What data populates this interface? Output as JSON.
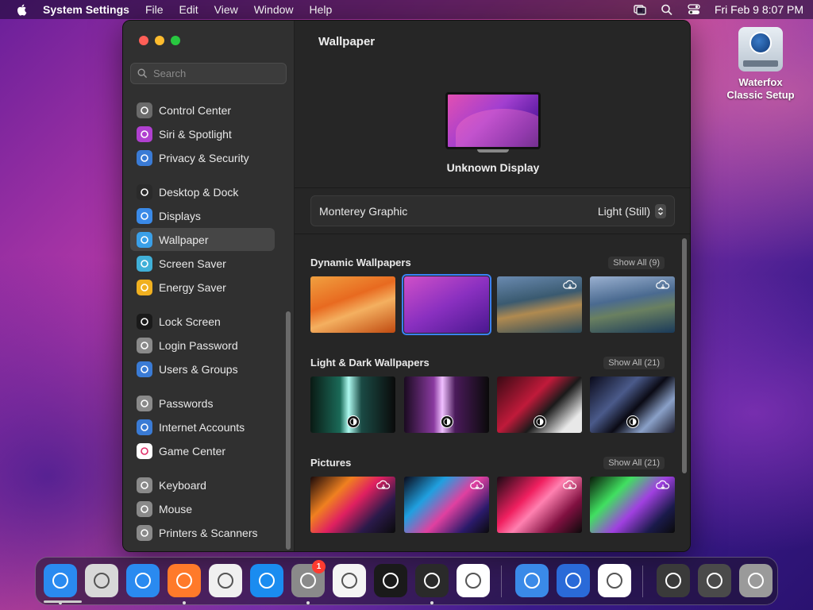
{
  "menubar": {
    "app_name": "System Settings",
    "items": [
      "File",
      "Edit",
      "View",
      "Window",
      "Help"
    ],
    "clock": "Fri Feb 9  8:07 PM"
  },
  "desktop": {
    "icon_label": "Waterfox Classic Setup"
  },
  "sidebar": {
    "search_placeholder": "Search",
    "items": [
      {
        "label": "Control Center",
        "icon": "control-center-icon",
        "color": "#6b6b6b"
      },
      {
        "label": "Siri & Spotlight",
        "icon": "siri-icon",
        "color": "#b040d0"
      },
      {
        "label": "Privacy & Security",
        "icon": "hand-icon",
        "color": "#3a7bd5"
      },
      {
        "label": "Desktop & Dock",
        "icon": "dock-icon",
        "color": "#2a2a2a"
      },
      {
        "label": "Displays",
        "icon": "sun-icon",
        "color": "#3a8ae8"
      },
      {
        "label": "Wallpaper",
        "icon": "flower-icon",
        "color": "#3aa0e8"
      },
      {
        "label": "Screen Saver",
        "icon": "screen-saver-icon",
        "color": "#40b0d8"
      },
      {
        "label": "Energy Saver",
        "icon": "lightbulb-icon",
        "color": "#f0b020"
      },
      {
        "label": "Lock Screen",
        "icon": "lock-icon",
        "color": "#1a1a1a"
      },
      {
        "label": "Login Password",
        "icon": "password-lock-icon",
        "color": "#8a8a8a"
      },
      {
        "label": "Users & Groups",
        "icon": "users-icon",
        "color": "#3a7bd5"
      },
      {
        "label": "Passwords",
        "icon": "key-icon",
        "color": "#8a8a8a"
      },
      {
        "label": "Internet Accounts",
        "icon": "at-icon",
        "color": "#3a7bd5"
      },
      {
        "label": "Game Center",
        "icon": "game-center-icon",
        "color": "#ffffff"
      },
      {
        "label": "Keyboard",
        "icon": "keyboard-icon",
        "color": "#8a8a8a"
      },
      {
        "label": "Mouse",
        "icon": "mouse-icon",
        "color": "#8a8a8a"
      },
      {
        "label": "Printers & Scanners",
        "icon": "printer-icon",
        "color": "#8a8a8a"
      }
    ],
    "active": "Wallpaper"
  },
  "content": {
    "title": "Wallpaper",
    "display_name": "Unknown Display",
    "wallpaper_name": "Monterey Graphic",
    "wallpaper_mode": "Light (Still)",
    "sections": [
      {
        "title": "Dynamic Wallpapers",
        "show_all": "Show All (9)"
      },
      {
        "title": "Light & Dark Wallpapers",
        "show_all": "Show All (21)"
      },
      {
        "title": "Pictures",
        "show_all": "Show All (21)"
      }
    ]
  },
  "dock": {
    "apps": [
      {
        "name": "finder-icon",
        "color": "#2a8af0"
      },
      {
        "name": "launchpad-icon",
        "color": "#d8d8d8"
      },
      {
        "name": "safari-icon",
        "color": "#2a8af0"
      },
      {
        "name": "firefox-icon",
        "color": "#ff7a2a"
      },
      {
        "name": "chrome-icon",
        "color": "#f0f0f0"
      },
      {
        "name": "app-store-icon",
        "color": "#1a8cf0"
      },
      {
        "name": "system-settings-icon",
        "color": "#8a8a8a"
      },
      {
        "name": "textedit-icon",
        "color": "#f4f4f4"
      },
      {
        "name": "terminal-icon",
        "color": "#1a1a1a"
      },
      {
        "name": "garageband-icon",
        "color": "#2a2a2a"
      },
      {
        "name": "vscode-icon",
        "color": "#ffffff"
      },
      {
        "name": "weather-icon",
        "color": "#3a8ae8"
      },
      {
        "name": "waterfox-classic-icon",
        "color": "#2a6ad8"
      },
      {
        "name": "photos-icon",
        "color": "#ffffff"
      },
      {
        "name": "recent-window-icon",
        "color": "#3a3a3a"
      },
      {
        "name": "downloads-stack-icon",
        "color": "#4a4a4a"
      },
      {
        "name": "trash-icon",
        "color": "#9a9a9a"
      }
    ],
    "badge_count": "1"
  }
}
